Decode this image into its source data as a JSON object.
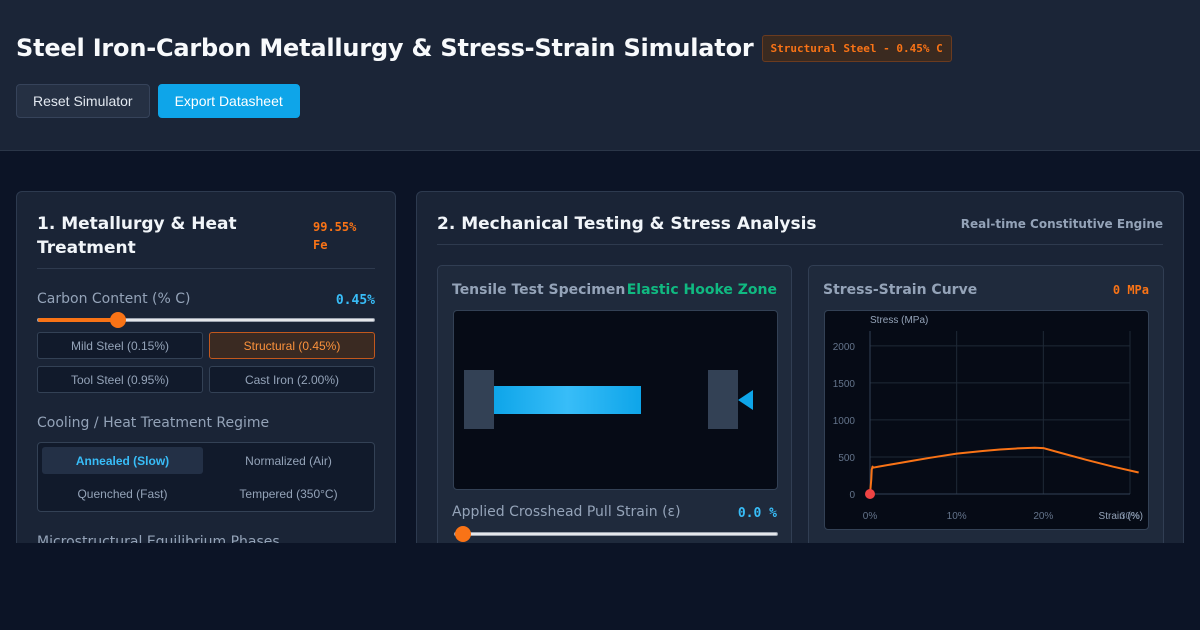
{
  "header": {
    "title": "Steel Iron-Carbon Metallurgy & Stress-Strain Simulator",
    "badge": "Structural Steel - 0.45% C",
    "reset_label": "Reset Simulator",
    "export_label": "Export Datasheet"
  },
  "metallurgy": {
    "title": "1. Metallurgy & Heat Treatment",
    "iron_fraction": "99.55% Fe",
    "carbon_label": "Carbon Content (% C)",
    "carbon_value": "0.45%",
    "carbon_slider": {
      "value": 0.45,
      "min": 0,
      "max": 2.0
    },
    "presets": [
      {
        "label": "Mild Steel (0.15%)",
        "active": false
      },
      {
        "label": "Structural (0.45%)",
        "active": true
      },
      {
        "label": "Tool Steel (0.95%)",
        "active": false
      },
      {
        "label": "Cast Iron (2.00%)",
        "active": false
      }
    ],
    "cooling_label": "Cooling / Heat Treatment Regime",
    "regimes": [
      {
        "label": "Annealed (Slow)",
        "active": true
      },
      {
        "label": "Normalized (Air)",
        "active": false
      },
      {
        "label": "Quenched (Fast)",
        "active": false
      },
      {
        "label": "Tempered (350°C)",
        "active": false
      }
    ],
    "phases_label": "Microstructural Equilibrium Phases"
  },
  "testing": {
    "title": "2. Mechanical Testing & Stress Analysis",
    "subtitle": "Real-time Constitutive Engine",
    "specimen": {
      "title": "Tensile Test Specimen",
      "zone": "Elastic Hooke Zone",
      "strain_label": "Applied Crosshead Pull Strain (ε)",
      "strain_value": "0.0 %",
      "strain_slider": {
        "value": 0.0,
        "min": 0,
        "max": 30
      }
    },
    "curve_panel": {
      "title": "Stress-Strain Curve",
      "current_stress": "0 MPa"
    }
  },
  "colors": {
    "accent_orange": "#f97316",
    "accent_blue": "#0ea5e9",
    "elastic_green": "#10b981",
    "background": "#0c1426",
    "panel": "#1a2436"
  },
  "chart_data": {
    "type": "line",
    "title": "",
    "ylabel": "Stress (MPa)",
    "xlabel": "Strain (%)",
    "x_tick_labels": [
      "0%",
      "10%",
      "20%",
      "30%"
    ],
    "y_tick_labels": [
      "0",
      "500",
      "1000",
      "1500",
      "2000"
    ],
    "xlim": [
      0,
      30
    ],
    "ylim": [
      0,
      2200
    ],
    "grid": true,
    "series": [
      {
        "x": [
          0,
          0.15,
          0.2,
          0.3,
          0.35,
          1,
          3,
          5,
          7,
          10,
          13,
          15,
          17,
          19,
          20,
          22,
          25,
          28,
          31
        ],
        "y": [
          0,
          200,
          330,
          370,
          355,
          370,
          410,
          450,
          490,
          545,
          580,
          600,
          615,
          625,
          620,
          555,
          460,
          370,
          290
        ]
      }
    ],
    "current_point": {
      "x": 0,
      "y": 0
    }
  }
}
